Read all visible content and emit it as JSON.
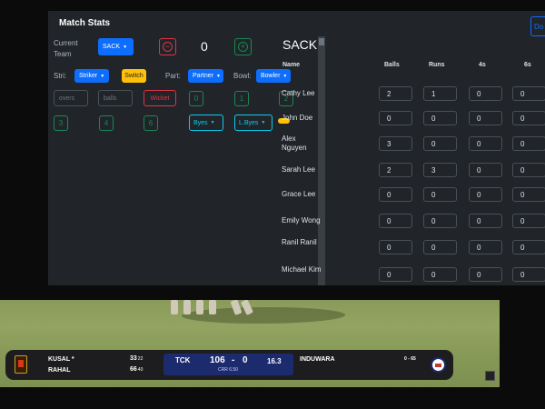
{
  "panel": {
    "title": "Match Stats",
    "done_label": "Do",
    "current_team_label": "Current\nTeam",
    "team_select": "SACK",
    "score_value": "0",
    "minus": "−",
    "plus": "+",
    "stri_label": "Stri:",
    "striker_select": "Striker",
    "switch_label": "Switch",
    "part_label": "Part:",
    "partner_select": "Partner",
    "bowl_label": "Bowl:",
    "bowler_select": "Bowler",
    "overs_placeholder": "overs",
    "balls_placeholder": "balls",
    "wicket_label": "Wicket",
    "run_buttons": [
      "0",
      "1",
      "2",
      "3",
      "4",
      "6"
    ],
    "byes_select": "Byes",
    "lbyes_select": "L.Byes"
  },
  "stats": {
    "team": "SACK",
    "headers": [
      "Name",
      "Balls",
      "Runs",
      "4s",
      "6s"
    ],
    "rows": [
      {
        "name": "Cathy Lee",
        "values": [
          "2",
          "1",
          "0",
          "0"
        ]
      },
      {
        "name": "John Doe",
        "values": [
          "0",
          "0",
          "0",
          "0"
        ]
      },
      {
        "name": "Alex Nguyen",
        "values": [
          "3",
          "0",
          "0",
          "0"
        ]
      },
      {
        "name": "Sarah Lee",
        "values": [
          "2",
          "3",
          "0",
          "0"
        ]
      },
      {
        "name": "Grace Lee",
        "values": [
          "0",
          "0",
          "0",
          "0"
        ]
      },
      {
        "name": "Emily Wong",
        "values": [
          "0",
          "0",
          "0",
          "0"
        ]
      },
      {
        "name": "Ranil Ranil",
        "values": [
          "0",
          "0",
          "0",
          "0"
        ]
      },
      {
        "name": "Michael Kim",
        "values": [
          "0",
          "0",
          "0",
          "0"
        ]
      }
    ]
  },
  "scorebar": {
    "batter1": "KUSAL *",
    "batter1_runs": "33",
    "batter1_balls": "22",
    "batter2": "RAHAL",
    "batter2_runs": "66",
    "batter2_balls": "40",
    "team": "TCK",
    "runs": "106",
    "sep": "-",
    "wickets": "0",
    "overs": "16.3",
    "crr": "CRR 6.50",
    "bowler": "INDUWARA",
    "bowler_figures": "0 - 65"
  }
}
